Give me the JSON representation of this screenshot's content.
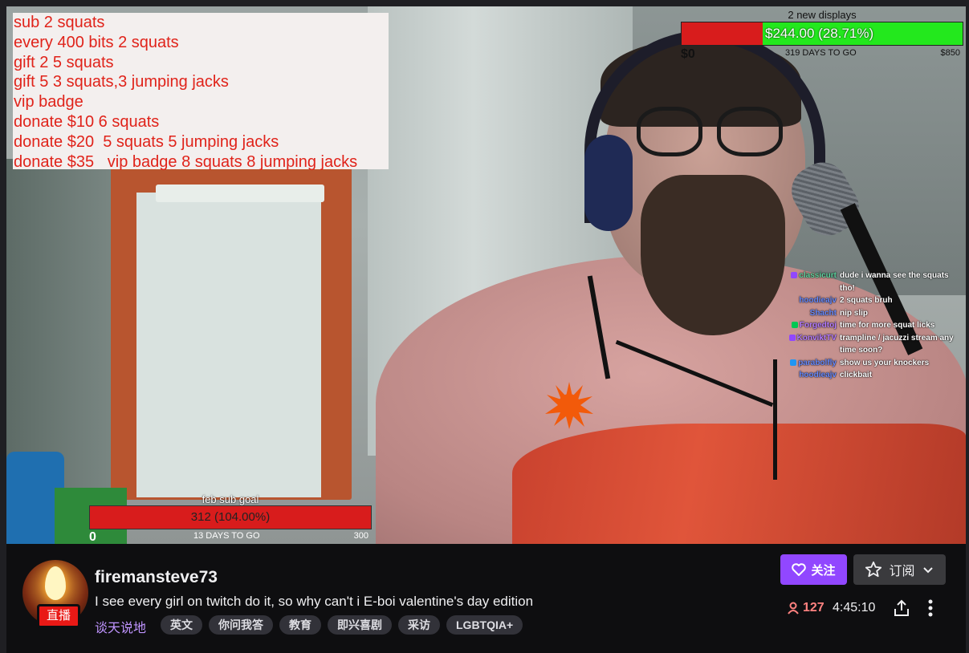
{
  "overlay": {
    "rules": [
      "sub 2 squats",
      "every 400 bits 2 squats",
      "gift 2 5 squats",
      "gift 5 3 squats,3 jumping jacks",
      "vip badge",
      "donate $10 6 squats",
      "donate $20  5 squats 5 jumping jacks",
      "donate $35   vip badge 8 squats 8 jumping jacks"
    ],
    "goal_top": {
      "label": "2 new displays",
      "value_text": "$244.00 (28.71%)",
      "progress_fraction": 0.2871,
      "min": "$0",
      "days": "319 DAYS TO GO",
      "max": "$850",
      "colors": {
        "bar": "#d81c1c",
        "fill": "#23e81d"
      }
    },
    "goal_bottom": {
      "label": "feb sub goal",
      "value_text": "312 (104.00%)",
      "progress_fraction": 1.04,
      "min": "0",
      "days": "13 DAYS TO GO",
      "max": "300",
      "colors": {
        "bar": "#d81c1c"
      }
    },
    "chat": [
      {
        "user": "classicurt",
        "color": "#5fd4a0",
        "badge": "#9147ff",
        "text": "dude i wanna see the squats"
      },
      {
        "user": "",
        "color": "#ffffff",
        "badge": "",
        "text": "tho!"
      },
      {
        "user": "hoodieajv",
        "color": "#6a8cff",
        "badge": "",
        "text": "2 squats bruh"
      },
      {
        "user": "Shacht",
        "color": "#6a8cff",
        "badge": "",
        "text": "nip slip"
      },
      {
        "user": "Forgedtoj",
        "color": "#b57cff",
        "badge": "#00c853",
        "text": "time for more squat licks"
      },
      {
        "user": "KonviktTV",
        "color": "#b57cff",
        "badge": "#9147ff",
        "text": "trampline / jacuzzi stream any"
      },
      {
        "user": "",
        "color": "#ffffff",
        "badge": "",
        "text": "time soon?"
      },
      {
        "user": "parabolfly",
        "color": "#6a8cff",
        "badge": "#2196f3",
        "text": "show us your knockers"
      },
      {
        "user": "hoodieajv",
        "color": "#6a8cff",
        "badge": "",
        "text": "clickbait"
      }
    ]
  },
  "channel": {
    "name": "firemansteve73",
    "live_badge": "直播",
    "title": "I see every girl on twitch do it, so why can't i E-boi valentine's day edition",
    "category": "谈天说地",
    "tags": [
      "英文",
      "你问我答",
      "教育",
      "即兴喜剧",
      "采访",
      "LGBTQIA+"
    ]
  },
  "actions": {
    "follow_label": "关注",
    "subscribe_label": "订阅",
    "viewers": "127",
    "uptime": "4:45:10",
    "accent": "#9147ff",
    "viewer_color": "#ff8280"
  },
  "icons": {
    "follow": "heart-icon",
    "subscribe": "star-icon",
    "subscribe_menu": "chevron-down-icon",
    "viewers": "person-icon",
    "share": "share-icon",
    "more": "more-vertical-icon"
  }
}
